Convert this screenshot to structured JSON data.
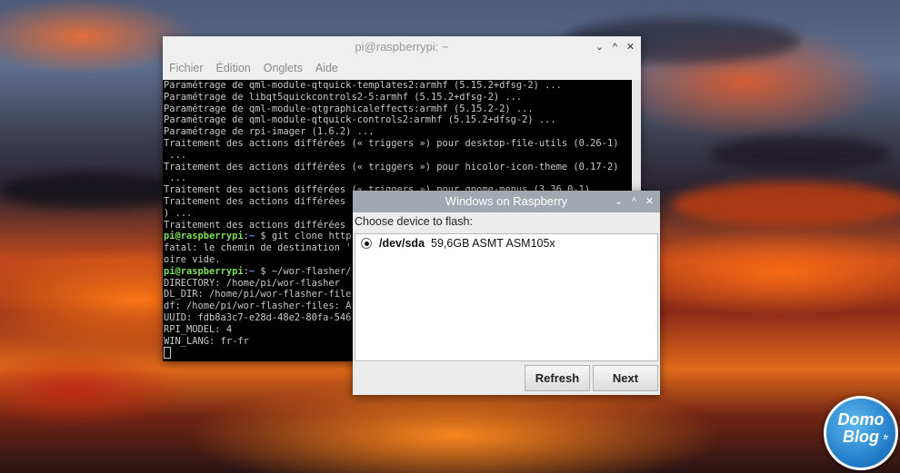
{
  "terminal": {
    "title": "pi@raspberrypi: ~",
    "controls": [
      "⌄",
      "^",
      "✕"
    ],
    "menu": [
      "Fichier",
      "Édition",
      "Onglets",
      "Aide"
    ],
    "lines": [
      {
        "text": "Paramétrage de qml-module-qtquick-templates2:armhf (5.15.2+dfsg-2) ..."
      },
      {
        "text": "Paramétrage de libqt5quickcontrols2-5:armhf (5.15.2+dfsg-2) ..."
      },
      {
        "text": "Paramétrage de qml-module-qtgraphicaleffects:armhf (5.15.2-2) ..."
      },
      {
        "text": "Paramétrage de qml-module-qtquick-controls2:armhf (5.15.2+dfsg-2) ..."
      },
      {
        "text": "Paramétrage de rpi-imager (1.6.2) ..."
      },
      {
        "text": "Traitement des actions différées (« triggers ») pour desktop-file-utils (0.26-1)"
      },
      {
        "text": " ..."
      },
      {
        "text": "Traitement des actions différées (« triggers ») pour hicolor-icon-theme (0.17-2)"
      },
      {
        "text": " ..."
      },
      {
        "text": "Traitement des actions différées (« triggers ») pour gnome-menus (3.36.0-1)"
      },
      {
        "text": "Traitement des actions différées"
      },
      {
        "text": ") ..."
      },
      {
        "text": "Traitement des actions différées"
      },
      {
        "user": "pi@raspberrypi",
        "sep": ":",
        "path": "~",
        "text": " $ git clone http"
      },
      {
        "text": "fatal: le chemin de destination '"
      },
      {
        "text": "oire vide."
      },
      {
        "user": "pi@raspberrypi",
        "sep": ":",
        "path": "~",
        "text": " $ ~/wor-flasher/"
      },
      {
        "text": "DIRECTORY: /home/pi/wor-flasher"
      },
      {
        "text": "DL_DIR: /home/pi/wor-flasher-file"
      },
      {
        "text": "df: /home/pi/wor-flasher-files: A"
      },
      {
        "text": "UUID: fdb8a3c7-e28d-48e2-80fa-546"
      },
      {
        "text": "RPI_MODEL: 4"
      },
      {
        "text": "WIN_LANG: fr-fr"
      }
    ]
  },
  "dialog": {
    "title": "Windows on Raspberry",
    "controls": [
      "⌄",
      "^",
      "✕"
    ],
    "prompt": "Choose device to flash:",
    "device": {
      "path": "/dev/sda",
      "info": "59,6GB  ASMT ASM105x",
      "selected": true
    },
    "refresh_label": "Refresh",
    "next_label": "Next"
  },
  "logo": {
    "line1": "Domo",
    "line2": "Blog",
    "suffix": "fr"
  }
}
